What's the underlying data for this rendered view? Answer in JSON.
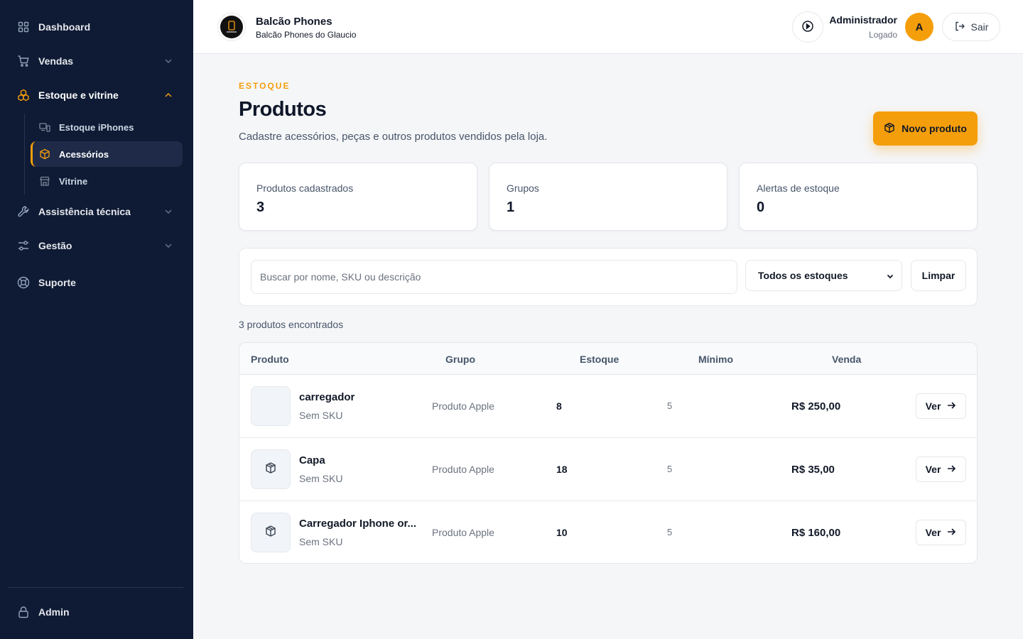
{
  "sidebar": {
    "items": [
      {
        "label": "Dashboard",
        "icon": "grid-icon"
      },
      {
        "label": "Vendas",
        "icon": "cart-icon"
      },
      {
        "label": "Estoque e vitrine",
        "icon": "boxes-icon"
      },
      {
        "label": "Assistência técnica",
        "icon": "wrench-icon"
      },
      {
        "label": "Gestão",
        "icon": "sliders-icon"
      },
      {
        "label": "Suporte",
        "icon": "lifebuoy-icon"
      }
    ],
    "subitems": [
      {
        "label": "Estoque iPhones",
        "icon": "devices-icon"
      },
      {
        "label": "Acessórios",
        "icon": "package-icon"
      },
      {
        "label": "Vitrine",
        "icon": "store-icon"
      }
    ],
    "footer": {
      "label": "Admin",
      "icon": "lock-icon"
    }
  },
  "header": {
    "brand_name": "Balcão Phones",
    "brand_sub": "Balcão Phones do Glaucio",
    "user_name": "Administrador",
    "user_status": "Logado",
    "avatar_initial": "A",
    "logout_label": "Sair"
  },
  "page": {
    "eyebrow": "ESTOQUE",
    "title": "Produtos",
    "description": "Cadastre acessórios, peças e outros produtos vendidos pela loja.",
    "new_button": "Novo produto"
  },
  "stats": [
    {
      "label": "Produtos cadastrados",
      "value": "3"
    },
    {
      "label": "Grupos",
      "value": "1"
    },
    {
      "label": "Alertas de estoque",
      "value": "0"
    }
  ],
  "filters": {
    "search_placeholder": "Buscar por nome, SKU ou descrição",
    "stock_selected": "Todos os estoques",
    "clear_label": "Limpar"
  },
  "results_text": "3 produtos encontrados",
  "table": {
    "columns": [
      "Produto",
      "Grupo",
      "Estoque",
      "Mínimo",
      "Venda"
    ],
    "rows": [
      {
        "name": "carregador",
        "sku": "Sem SKU",
        "group": "Produto Apple",
        "stock": "8",
        "minimum": "5",
        "price": "R$ 250,00",
        "action": "Ver",
        "thumb_icon": "none"
      },
      {
        "name": "Capa",
        "sku": "Sem SKU",
        "group": "Produto Apple",
        "stock": "18",
        "minimum": "5",
        "price": "R$ 35,00",
        "action": "Ver",
        "thumb_icon": "package-icon"
      },
      {
        "name": "Carregador Iphone or...",
        "sku": "Sem SKU",
        "group": "Produto Apple",
        "stock": "10",
        "minimum": "5",
        "price": "R$ 160,00",
        "action": "Ver",
        "thumb_icon": "package-icon"
      }
    ]
  },
  "colors": {
    "sidebar_bg": "#0f1b35",
    "accent": "#f59e0b",
    "page_bg": "#f5f6f8"
  }
}
